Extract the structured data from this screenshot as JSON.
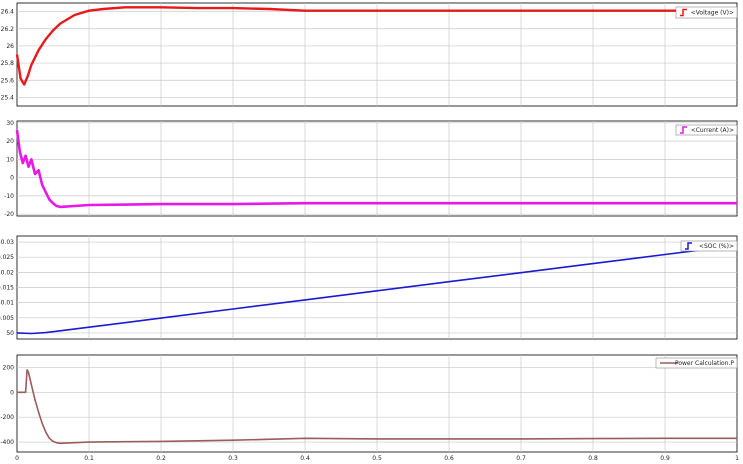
{
  "app": "Scope",
  "colors": {
    "background": "#ffffff",
    "axes_bg": "#ffffff",
    "grid": "#c8c8c8",
    "axis": "#000000",
    "voltage": "#e8191b",
    "current": "#e619e6",
    "soc": "#1a1ad2",
    "power": "#9a5c5c"
  },
  "chart_data": [
    {
      "type": "line",
      "legend": "<Voltage (V)>",
      "legend_position": "top-right",
      "grid": true,
      "xlim": [
        0,
        1
      ],
      "ylim": [
        25.3,
        26.5
      ],
      "yticks": [
        "26.4",
        "26.2",
        "26",
        "25.8",
        "25.6",
        "25.4"
      ],
      "series": [
        {
          "name": "<Voltage (V)>",
          "x": [
            0,
            0.005,
            0.01,
            0.015,
            0.02,
            0.03,
            0.04,
            0.05,
            0.06,
            0.08,
            0.1,
            0.12,
            0.15,
            0.2,
            0.25,
            0.3,
            0.35,
            0.4,
            0.5,
            0.6,
            0.7,
            0.8,
            0.9,
            1.0
          ],
          "y": [
            25.9,
            25.62,
            25.55,
            25.65,
            25.78,
            25.95,
            26.08,
            26.18,
            26.26,
            26.36,
            26.41,
            26.43,
            26.45,
            26.45,
            26.44,
            26.44,
            26.43,
            26.41,
            26.41,
            26.41,
            26.41,
            26.41,
            26.41,
            26.41
          ]
        }
      ]
    },
    {
      "type": "line",
      "legend": "<Current (A)>",
      "legend_position": "top-right",
      "grid": true,
      "xlim": [
        0,
        1
      ],
      "ylim": [
        -21,
        31
      ],
      "yticks": [
        "30",
        "20",
        "10",
        "0",
        "-10",
        "-20"
      ],
      "series": [
        {
          "name": "<Current (A)>",
          "x": [
            0,
            0.004,
            0.008,
            0.012,
            0.016,
            0.02,
            0.025,
            0.03,
            0.035,
            0.04,
            0.045,
            0.05,
            0.055,
            0.06,
            0.08,
            0.1,
            0.2,
            0.3,
            0.4,
            0.5,
            0.6,
            0.7,
            0.8,
            0.9,
            1.0
          ],
          "y": [
            26,
            14,
            8,
            12,
            6,
            10,
            2,
            4,
            -4,
            -8,
            -12,
            -14,
            -15.5,
            -16,
            -15.5,
            -15,
            -14.5,
            -14.5,
            -14,
            -14,
            -14,
            -14,
            -14,
            -14,
            -14
          ]
        }
      ]
    },
    {
      "type": "line",
      "legend": "<SOC (%)>",
      "legend_position": "top-right",
      "grid": true,
      "xlim": [
        0,
        1
      ],
      "ylim": [
        49.998,
        50.032
      ],
      "yticks": [
        "50.03",
        "50.025",
        "50.02",
        "50.015",
        "50.01",
        "50.005",
        "50"
      ],
      "series": [
        {
          "name": "<SOC (%)>",
          "x": [
            0,
            0.02,
            0.04,
            0.06,
            0.1,
            0.2,
            0.3,
            0.4,
            0.5,
            0.6,
            0.7,
            0.8,
            0.9,
            1.0
          ],
          "y": [
            50.0,
            49.9998,
            50.0001,
            50.0007,
            50.0019,
            50.0049,
            50.0079,
            50.0109,
            50.0139,
            50.0169,
            50.0199,
            50.0229,
            50.0259,
            50.0289
          ]
        }
      ]
    },
    {
      "type": "line",
      "legend": "Power Calculation.P",
      "legend_position": "top-right",
      "grid": true,
      "xlim": [
        0,
        1
      ],
      "ylim": [
        -480,
        300
      ],
      "xticks": [
        "0",
        "0.1",
        "0.2",
        "0.3",
        "0.4",
        "0.5",
        "0.6",
        "0.7",
        "0.8",
        "0.9",
        "1"
      ],
      "yticks": [
        "200",
        "0",
        "-200",
        "-400"
      ],
      "series": [
        {
          "name": "Power Calculation.P",
          "x": [
            0,
            0.012,
            0.014,
            0.016,
            0.02,
            0.025,
            0.03,
            0.035,
            0.04,
            0.045,
            0.05,
            0.055,
            0.06,
            0.08,
            0.1,
            0.2,
            0.3,
            0.4,
            0.5,
            0.6,
            0.7,
            0.8,
            0.9,
            1.0
          ],
          "y": [
            0,
            0,
            180,
            160,
            60,
            -60,
            -160,
            -250,
            -320,
            -370,
            -395,
            -405,
            -410,
            -405,
            -400,
            -395,
            -385,
            -370,
            -375,
            -375,
            -375,
            -372,
            -370,
            -370
          ]
        }
      ]
    }
  ]
}
